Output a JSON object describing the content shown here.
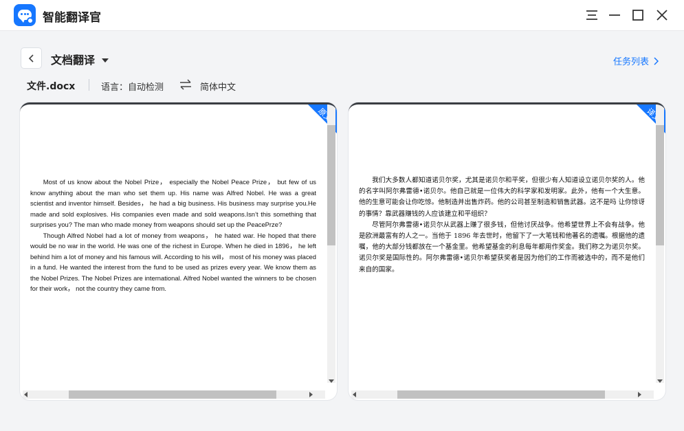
{
  "app": {
    "title": "智能翻译官",
    "colors": {
      "accent": "#1677ff",
      "background": "#f3f4f6"
    }
  },
  "window_controls": {
    "menu_icon": "hamburger-icon",
    "minimize_icon": "minimize-icon",
    "maximize_icon": "maximize-icon",
    "close_icon": "close-icon"
  },
  "header": {
    "back_icon": "chevron-left-icon",
    "title": "文档翻译",
    "title_dropdown_icon": "caret-down-icon",
    "task_list_label": "任务列表",
    "task_list_icon": "chevron-right-icon"
  },
  "file_bar": {
    "file_name": "文件.docx",
    "language_label": "语言：自动检测",
    "swap_icon": "swap-arrows-icon",
    "target_language": "简体中文"
  },
  "source_panel": {
    "badge": "原文",
    "paragraphs": [
      "Most of us know about the Nobel Prize， especially the Nobel Peace Prize， but few of us know anything about the man who set them up. His name was Alfred Nobel. He was a great scientist and inventor himself. Besides， he had a big business. His business may surprise you.He made and sold explosives. His companies even made and sold weapons.Isn’t this something that surprises you? The man who made money from weapons should set up the PeacePrze?",
      "Though Alfred Nobel had a lot of money from weapons， he hated war. He hoped that there would be no war in the world. He was one of the richest in Europe. When he died in 1896， he left behind him a lot of money and his famous will. According to his will， most of his money was placed in a fund. He wanted the interest from the fund to be used as prizes every year. We know them as the Nobel Prizes. The Nobel Prizes are international. Alfred Nobel wanted the winners to be chosen for their work， not the country they came from."
    ]
  },
  "target_panel": {
    "badge": "译文",
    "paragraphs": [
      "我们大多数人都知道诺贝尔奖，尤其是诺贝尔和平奖，但很少有人知道设立诺贝尔奖的人。他的名字叫阿尔弗雷德•诺贝尔。他自己就是一位伟大的科学家和发明家。此外，他有一个大生意。他的生意可能会让你吃惊。他制造并出售炸药。他的公司甚至制造和销售武器。这不是吗 让你惊讶的事情？靠武器赚钱的人应该建立和平组织？",
      "尽管阿尔弗雷德•诺贝尔从武器上赚了很多钱，但他讨厌战争。他希望世界上不会有战争。他是欧洲最富有的人之一。当他于 1896 年去世时，他留下了一大笔钱和他著名的遗嘱。根据他的遗嘱，他的大部分钱都放在一个基金里。他希望基金的利息每年都用作奖金。我们称之为诺贝尔奖。诺贝尔奖是国际性的。阿尔弗雷德•诺贝尔希望获奖者是因为他们的工作而被选中的，而不是他们来自的国家。"
    ]
  }
}
